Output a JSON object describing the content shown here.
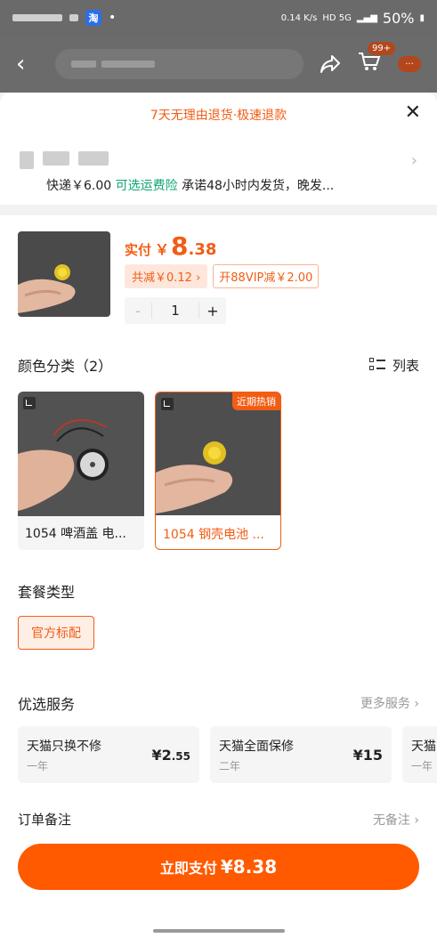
{
  "status_bar": {
    "app_icon": "淘",
    "net_speed": "0.14 K/s",
    "network": "HD 5G",
    "battery": "50%"
  },
  "page_header": {
    "cart_badge": "99+",
    "message_badge": "···"
  },
  "sheet": {
    "promo": "7天无理由退货·极速退款",
    "shipping": {
      "prefix": "快递￥6.00",
      "insurance": "可选运费险",
      "suffix": "承诺48小时内发货，晚发..."
    }
  },
  "product": {
    "price_label": "实付",
    "currency": "￥",
    "price_int": "8",
    "price_dec": ".38",
    "discount": "共减￥0.12 ›",
    "vip": "开88VIP减￥2.00",
    "quantity": "1",
    "minus": "-",
    "plus": "+"
  },
  "color_section": {
    "title": "颜色分类（2）",
    "toggle_label": "列表",
    "variants": [
      {
        "label": "1054 啤酒盖 电...",
        "selected": false
      },
      {
        "label": "1054 钢壳电池 ...",
        "selected": true,
        "badge": "近期热销"
      }
    ]
  },
  "package_section": {
    "title": "套餐类型",
    "option": "官方标配"
  },
  "services": {
    "title": "优选服务",
    "more": "更多服务 ›",
    "cards": [
      {
        "name": "天猫只换不修",
        "sub": "一年",
        "price_main": "¥2",
        "price_small": ".55"
      },
      {
        "name": "天猫全面保修",
        "sub": "二年",
        "price_main": "¥15",
        "price_small": ""
      },
      {
        "name": "天猫",
        "sub": "一年",
        "price_main": "",
        "price_small": ""
      }
    ]
  },
  "order_note": {
    "label": "订单备注",
    "value": "无备注 ›"
  },
  "pay_button": {
    "label": "立即支付",
    "amount": "¥8.38"
  },
  "colors": {
    "accent": "#f25d14",
    "pay_button": "#ff5a00",
    "green_link": "#0da572"
  }
}
